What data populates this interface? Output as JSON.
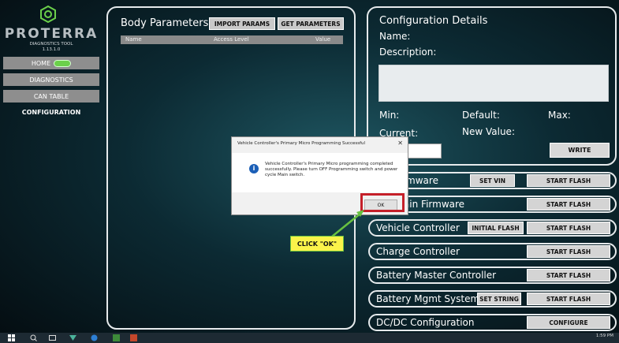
{
  "sidebar": {
    "brand": "PROTERRA",
    "subtitle": "DIAGNOSTICS TOOL",
    "version": "1.13.1.0",
    "nav": [
      {
        "label": "HOME"
      },
      {
        "label": "DIAGNOSTICS"
      },
      {
        "label": "CAN TABLE"
      },
      {
        "label": "CONFIGURATION"
      }
    ]
  },
  "body_params": {
    "title": "Body Parameters",
    "import_label": "IMPORT PARAMS",
    "get_label": "GET PARAMETERS",
    "columns": [
      "Name",
      "Access Level",
      "Value"
    ]
  },
  "config": {
    "title": "Configuration Details",
    "name_label": "Name:",
    "description_label": "Description:",
    "min_label": "Min:",
    "default_label": "Default:",
    "max_label": "Max:",
    "current_label": "Current:",
    "new_value_label": "New Value:",
    "write_label": "WRITE"
  },
  "rows": [
    {
      "label": "irmware",
      "mid": "SET VIN",
      "action": "START FLASH"
    },
    {
      "label": "rain Firmware",
      "mid": "",
      "action": "START FLASH"
    },
    {
      "label": "Vehicle Controller",
      "mid": "INITIAL FLASH",
      "action": "START FLASH"
    },
    {
      "label": "Charge Controller",
      "mid": "",
      "action": "START FLASH"
    },
    {
      "label": "Battery Master Controller",
      "mid": "",
      "action": "START FLASH"
    },
    {
      "label": "Battery Mgmt System",
      "mid": "SET STRING",
      "action": "START FLASH"
    },
    {
      "label": "DC/DC Configuration",
      "mid": "",
      "action": "CONFIGURE"
    }
  ],
  "dialog": {
    "title": "Vehicle Controller's Primary Micro Programming Successful",
    "message": "Vehicle Controller's Primary Micro programming completed successfully. Please turn OFF Programming switch and power cycle Main switch.",
    "ok_label": "OK",
    "close_glyph": "✕"
  },
  "callout": {
    "label": "CLICK \"OK\""
  },
  "taskbar": {
    "time": "1:59 PM"
  },
  "colors": {
    "accent_green": "#6bd04a",
    "highlight_red": "#c5202a",
    "callout_yellow": "#fbf34a"
  }
}
